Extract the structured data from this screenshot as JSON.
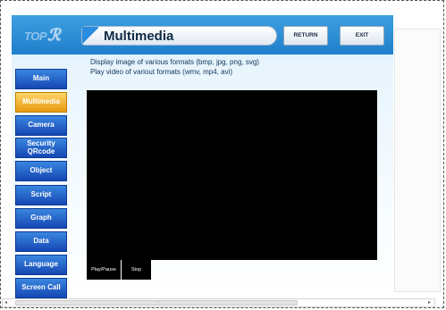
{
  "header": {
    "logo": "TOP",
    "title": "Multimedia",
    "return_label": "RETURN",
    "exit_label": "EXIT"
  },
  "sidebar": {
    "items": [
      {
        "label": "Main",
        "active": false
      },
      {
        "label": "Multimedia",
        "active": true
      },
      {
        "label": "Camera",
        "active": false
      },
      {
        "label": "Security\nQRcode",
        "active": false
      },
      {
        "label": "Object",
        "active": false
      },
      {
        "label": "Script",
        "active": false
      },
      {
        "label": "Graph",
        "active": false
      },
      {
        "label": "Data",
        "active": false
      },
      {
        "label": "Language",
        "active": false
      },
      {
        "label": "Screen Call",
        "active": false
      }
    ]
  },
  "main": {
    "line1": "Display image of various formats (bmp, jpg, png, svg)",
    "line2": "Play video of variout formats (wmv, mp4, avi)",
    "play_pause_label": "Play/Pause",
    "stop_label": "Stop"
  },
  "colors": {
    "active_nav": "#e79a10",
    "nav": "#1547b4",
    "header": "#2a8be0"
  }
}
